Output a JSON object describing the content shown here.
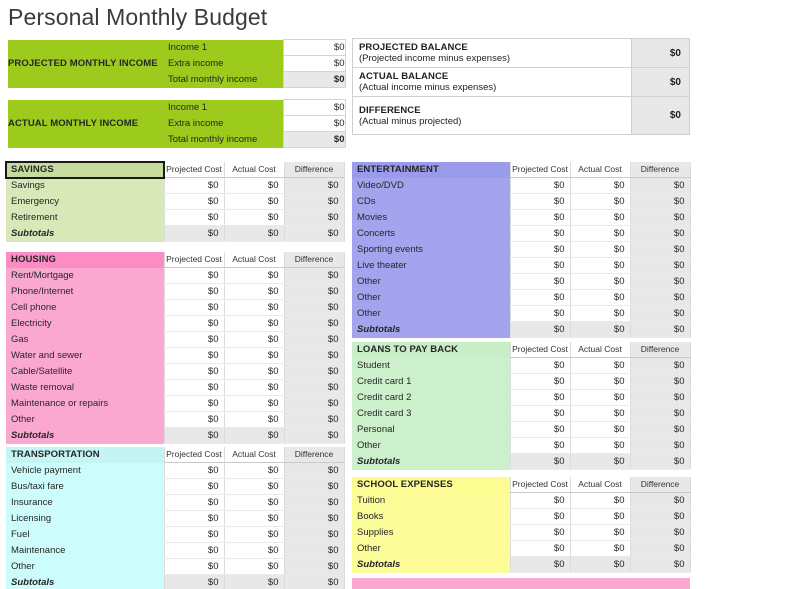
{
  "document": {
    "title": "Personal Monthly Budget"
  },
  "currency_zero": "$0",
  "columns": {
    "projected_cost": "Projected Cost",
    "actual_cost": "Actual Cost",
    "difference": "Difference"
  },
  "income_blocks": [
    {
      "label": "PROJECTED MONTHLY INCOME",
      "color": "#9ccb1e",
      "rows": [
        {
          "name": "Income 1",
          "value": "$0",
          "total": false
        },
        {
          "name": "Extra income",
          "value": "$0",
          "total": false
        },
        {
          "name": "Total monthly income",
          "value": "$0",
          "total": true
        }
      ]
    },
    {
      "label": "ACTUAL MONTHLY INCOME",
      "color": "#9ccb1e",
      "rows": [
        {
          "name": "Income 1",
          "value": "$0",
          "total": false
        },
        {
          "name": "Extra income",
          "value": "$0",
          "total": false
        },
        {
          "name": "Total monthly income",
          "value": "$0",
          "total": true
        }
      ]
    }
  ],
  "balances": [
    {
      "title": "PROJECTED BALANCE",
      "subtitle": "(Projected income minus expenses)",
      "amount": "$0"
    },
    {
      "title": "ACTUAL BALANCE",
      "subtitle": "(Actual income minus expenses)",
      "amount": "$0"
    },
    {
      "title": "DIFFERENCE",
      "subtitle": "(Actual minus projected)",
      "amount": "$0"
    }
  ],
  "subtotals_label": "Subtotals",
  "categories": [
    {
      "id": "savings",
      "name": "SAVINGS",
      "header_color": "#c6dc9c",
      "body_color": "#d8e8b8",
      "selected": true,
      "items": [
        {
          "label": "Savings",
          "projected": "$0",
          "actual": "$0",
          "difference": "$0"
        },
        {
          "label": "Emergency",
          "projected": "$0",
          "actual": "$0",
          "difference": "$0"
        },
        {
          "label": "Retirement",
          "projected": "$0",
          "actual": "$0",
          "difference": "$0"
        }
      ],
      "subtotals": {
        "projected": "$0",
        "actual": "$0",
        "difference": "$0"
      }
    },
    {
      "id": "housing",
      "name": "HOUSING",
      "header_color": "#fb8cc4",
      "body_color": "#fba8d0",
      "selected": false,
      "items": [
        {
          "label": "Rent/Mortgage",
          "projected": "$0",
          "actual": "$0",
          "difference": "$0"
        },
        {
          "label": "Phone/Internet",
          "projected": "$0",
          "actual": "$0",
          "difference": "$0"
        },
        {
          "label": "Cell phone",
          "projected": "$0",
          "actual": "$0",
          "difference": "$0"
        },
        {
          "label": "Electricity",
          "projected": "$0",
          "actual": "$0",
          "difference": "$0"
        },
        {
          "label": "Gas",
          "projected": "$0",
          "actual": "$0",
          "difference": "$0"
        },
        {
          "label": "Water and sewer",
          "projected": "$0",
          "actual": "$0",
          "difference": "$0"
        },
        {
          "label": "Cable/Satellite",
          "projected": "$0",
          "actual": "$0",
          "difference": "$0"
        },
        {
          "label": "Waste removal",
          "projected": "$0",
          "actual": "$0",
          "difference": "$0"
        },
        {
          "label": "Maintenance or repairs",
          "projected": "$0",
          "actual": "$0",
          "difference": "$0"
        },
        {
          "label": "Other",
          "projected": "$0",
          "actual": "$0",
          "difference": "$0"
        }
      ],
      "subtotals": {
        "projected": "$0",
        "actual": "$0",
        "difference": "$0"
      }
    },
    {
      "id": "transportation",
      "name": "TRANSPORTATION",
      "header_color": "#c4f4f4",
      "body_color": "#ccfcfc",
      "selected": false,
      "items": [
        {
          "label": "Vehicle payment",
          "projected": "$0",
          "actual": "$0",
          "difference": "$0"
        },
        {
          "label": "Bus/taxi fare",
          "projected": "$0",
          "actual": "$0",
          "difference": "$0"
        },
        {
          "label": "Insurance",
          "projected": "$0",
          "actual": "$0",
          "difference": "$0"
        },
        {
          "label": "Licensing",
          "projected": "$0",
          "actual": "$0",
          "difference": "$0"
        },
        {
          "label": "Fuel",
          "projected": "$0",
          "actual": "$0",
          "difference": "$0"
        },
        {
          "label": "Maintenance",
          "projected": "$0",
          "actual": "$0",
          "difference": "$0"
        },
        {
          "label": "Other",
          "projected": "$0",
          "actual": "$0",
          "difference": "$0"
        }
      ],
      "subtotals": {
        "projected": "$0",
        "actual": "$0",
        "difference": "$0"
      }
    },
    {
      "id": "entertainment",
      "name": "ENTERTAINMENT",
      "header_color": "#9b9bec",
      "body_color": "#a3a3ee",
      "selected": false,
      "items": [
        {
          "label": "Video/DVD",
          "projected": "$0",
          "actual": "$0",
          "difference": "$0"
        },
        {
          "label": "CDs",
          "projected": "$0",
          "actual": "$0",
          "difference": "$0"
        },
        {
          "label": "Movies",
          "projected": "$0",
          "actual": "$0",
          "difference": "$0"
        },
        {
          "label": "Concerts",
          "projected": "$0",
          "actual": "$0",
          "difference": "$0"
        },
        {
          "label": "Sporting events",
          "projected": "$0",
          "actual": "$0",
          "difference": "$0"
        },
        {
          "label": "Live theater",
          "projected": "$0",
          "actual": "$0",
          "difference": "$0"
        },
        {
          "label": "Other",
          "projected": "$0",
          "actual": "$0",
          "difference": "$0"
        },
        {
          "label": "Other",
          "projected": "$0",
          "actual": "$0",
          "difference": "$0"
        },
        {
          "label": "Other",
          "projected": "$0",
          "actual": "$0",
          "difference": "$0"
        }
      ],
      "subtotals": {
        "projected": "$0",
        "actual": "$0",
        "difference": "$0"
      }
    },
    {
      "id": "loans",
      "name": "LOANS TO PAY BACK",
      "header_color": "#c8eec8",
      "body_color": "#ccf0cc",
      "selected": false,
      "items": [
        {
          "label": "Student",
          "projected": "$0",
          "actual": "$0",
          "difference": "$0"
        },
        {
          "label": "Credit card 1",
          "projected": "$0",
          "actual": "$0",
          "difference": "$0"
        },
        {
          "label": "Credit card 2",
          "projected": "$0",
          "actual": "$0",
          "difference": "$0"
        },
        {
          "label": "Credit card 3",
          "projected": "$0",
          "actual": "$0",
          "difference": "$0"
        },
        {
          "label": "Personal",
          "projected": "$0",
          "actual": "$0",
          "difference": "$0"
        },
        {
          "label": "Other",
          "projected": "$0",
          "actual": "$0",
          "difference": "$0"
        }
      ],
      "subtotals": {
        "projected": "$0",
        "actual": "$0",
        "difference": "$0"
      }
    },
    {
      "id": "school",
      "name": "SCHOOL EXPENSES",
      "header_color": "#fcfc90",
      "body_color": "#fcfc98",
      "selected": false,
      "items": [
        {
          "label": "Tuition",
          "projected": "$0",
          "actual": "$0",
          "difference": "$0"
        },
        {
          "label": "Books",
          "projected": "$0",
          "actual": "$0",
          "difference": "$0"
        },
        {
          "label": "Supplies",
          "projected": "$0",
          "actual": "$0",
          "difference": "$0"
        },
        {
          "label": "Other",
          "projected": "$0",
          "actual": "$0",
          "difference": "$0"
        }
      ],
      "subtotals": {
        "projected": "$0",
        "actual": "$0",
        "difference": "$0"
      }
    }
  ],
  "clipped_category": {
    "header_color": "#fba8d0",
    "note": ""
  }
}
